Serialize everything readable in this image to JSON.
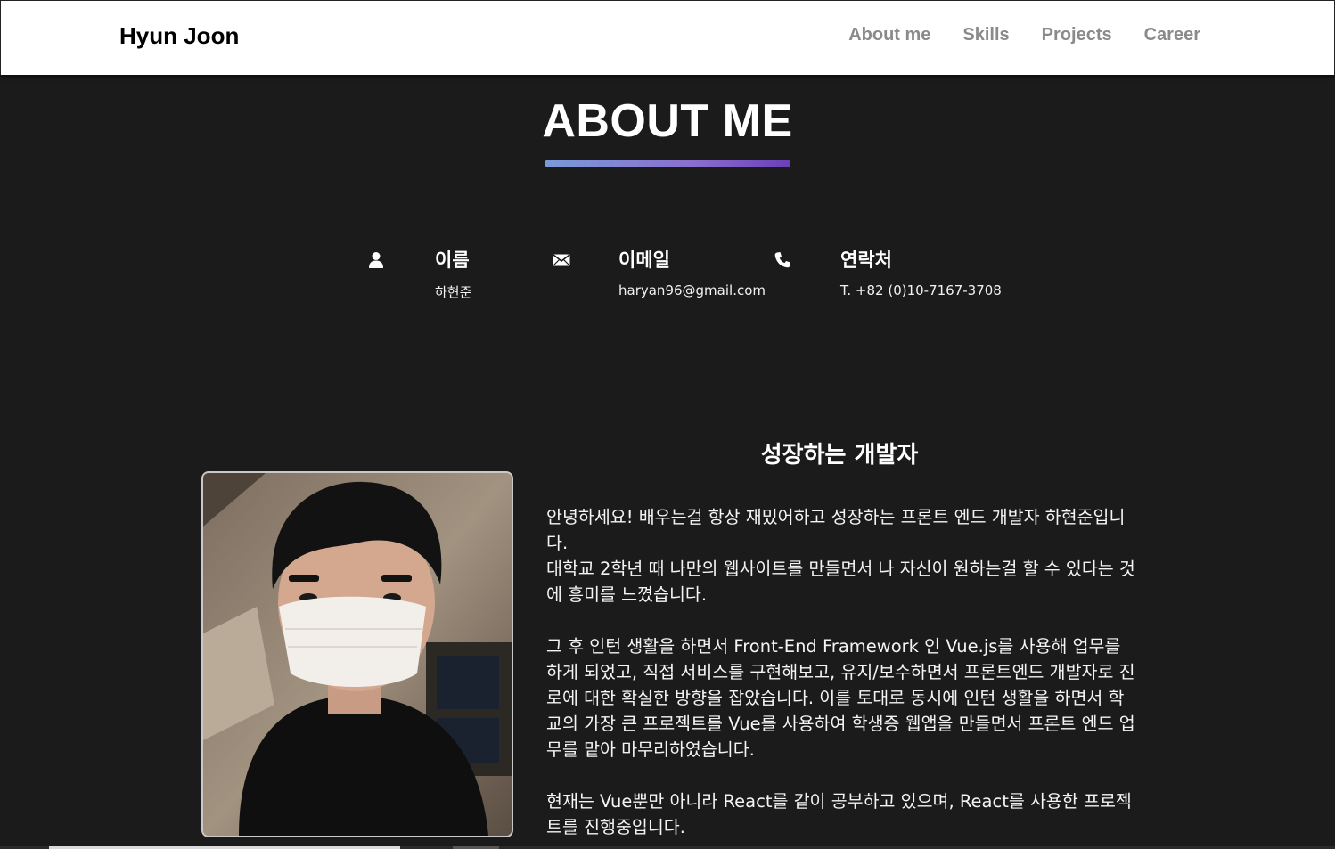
{
  "nav": {
    "brand": "Hyun Joon",
    "links": [
      "About me",
      "Skills",
      "Projects",
      "Career"
    ]
  },
  "about": {
    "title": "ABOUT ME",
    "info": [
      {
        "icon": "user-icon",
        "label": "이름",
        "value": "하현준"
      },
      {
        "icon": "envelope-icon",
        "label": "이메일",
        "value": "haryan96@gmail.com"
      },
      {
        "icon": "phone-icon",
        "label": "연락처",
        "value": "T. +82 (0)10-7167-3708"
      }
    ],
    "heading": "성장하는 개발자",
    "paragraphs": [
      "안녕하세요! 배우는걸 항상 재밌어하고 성장하는 프론트 엔드 개발자 하현준입니다.\n대학교 2학년 때 나만의 웹사이트를 만들면서 나 자신이 원하는걸 할 수 있다는 것에 흥미를 느꼈습니다.",
      "그 후 인턴 생활을 하면서 Front-End Framework 인 Vue.js를 사용해 업무를 하게 되었고, 직접 서비스를 구현해보고, 유지/보수하면서 프론트엔드 개발자로 진로에 대한 확실한 방향을 잡았습니다. 이를 토대로 동시에 인턴 생활을 하면서 학교의 가장 큰 프로젝트를 Vue를 사용하여 학생증 웹앱을 만들면서 프론트 엔드 업무를 맡아 마무리하였습니다.",
      "현재는 Vue뿐만 아니라 React를 같이 공부하고 있으며, React를 사용한 프로젝트를 진행중입니다."
    ]
  },
  "colors": {
    "background": "#1b1b1b",
    "navbar": "#ffffff",
    "nav_link": "#8a8a8a",
    "accent_gradient_start": "#7a9ad8",
    "accent_gradient_end": "#6a3fb8"
  }
}
